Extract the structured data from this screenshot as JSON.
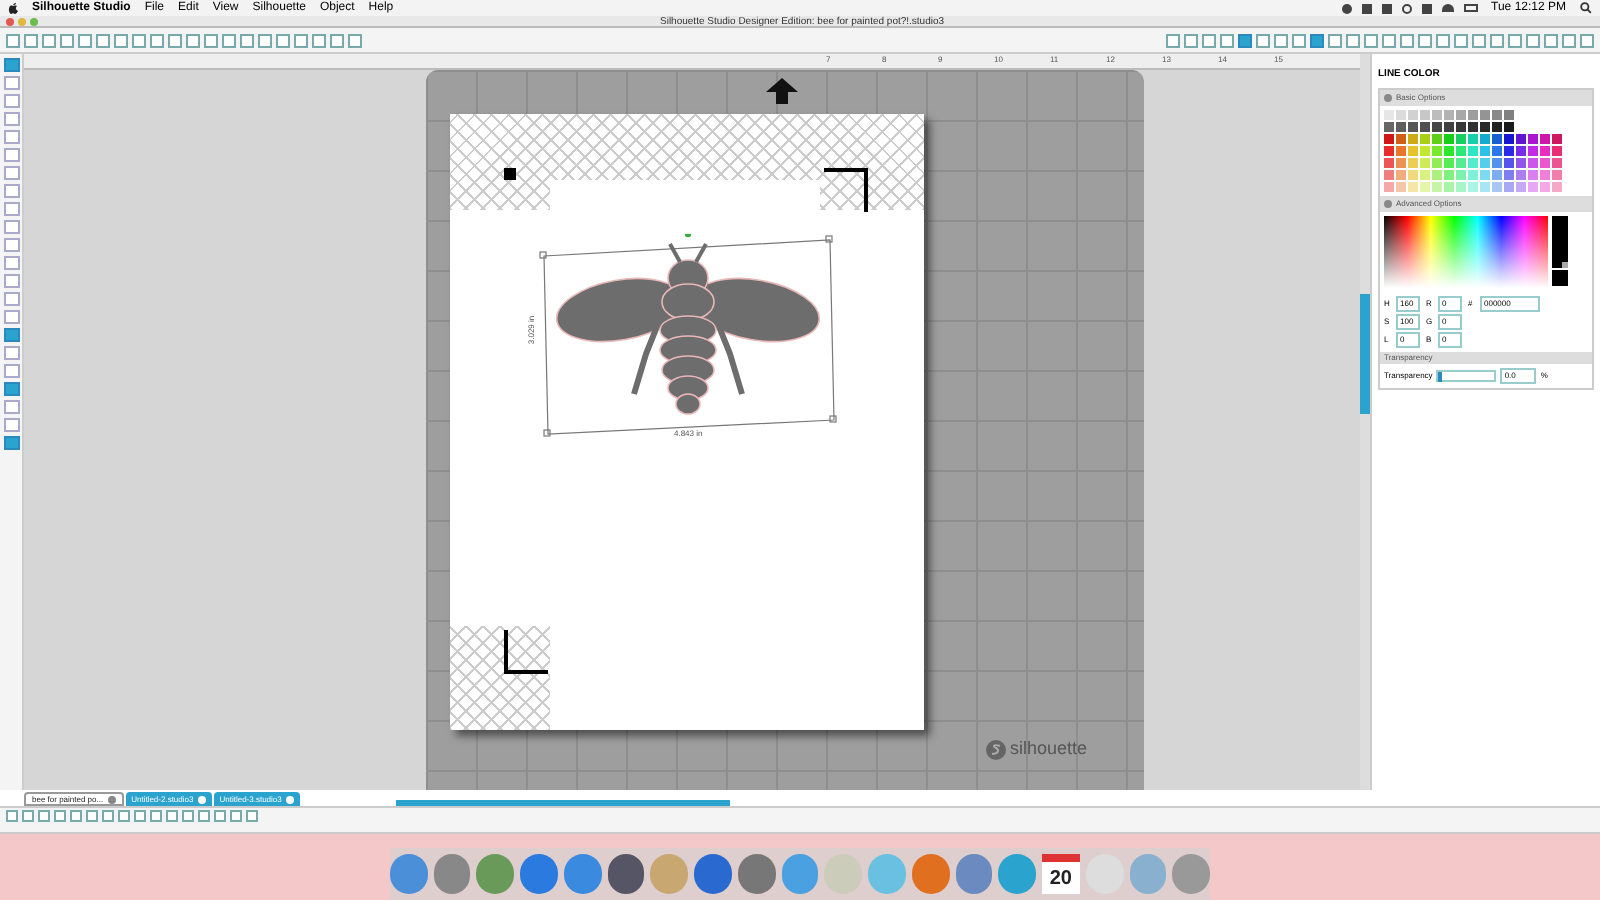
{
  "menu_bar": {
    "app": "Silhouette Studio",
    "menus": [
      "File",
      "Edit",
      "View",
      "Silhouette",
      "Object",
      "Help"
    ],
    "clock": "Tue 12:12 PM"
  },
  "window": {
    "title": "Silhouette Studio Designer Edition: bee for painted pot?!.studio3"
  },
  "ruler": {
    "labels": [
      "7",
      "8",
      "9",
      "10",
      "11",
      "12",
      "13",
      "14",
      "15"
    ]
  },
  "design": {
    "width_label": "4.843 in",
    "height_label": "3.029 in"
  },
  "mat": {
    "brand": "silhouette"
  },
  "panel": {
    "title": "LINE COLOR",
    "basic_options": "Basic Options",
    "advanced_options": "Advanced Options",
    "color_fields": [
      [
        {
          "label": "H",
          "value": "160"
        },
        {
          "label": "R",
          "value": "0"
        },
        {
          "label": "#",
          "value": "000000"
        }
      ],
      [
        {
          "label": "S",
          "value": "100"
        },
        {
          "label": "G",
          "value": "0"
        }
      ],
      [
        {
          "label": "L",
          "value": "0"
        },
        {
          "label": "B",
          "value": "0"
        }
      ]
    ],
    "lightness": {
      "level": 0
    },
    "transparency_header": "Transparency",
    "transparency_label": "Transparency",
    "transparency": {
      "level": 0,
      "value": "0.0",
      "unit": "%"
    }
  },
  "tabs": [
    {
      "label": "bee for painted po...",
      "selected": true
    },
    {
      "label": "Untitled-2.studio3",
      "selected": false
    },
    {
      "label": "Untitled-3.studio3",
      "selected": false
    }
  ],
  "dock": {
    "calendar_day": "20"
  }
}
